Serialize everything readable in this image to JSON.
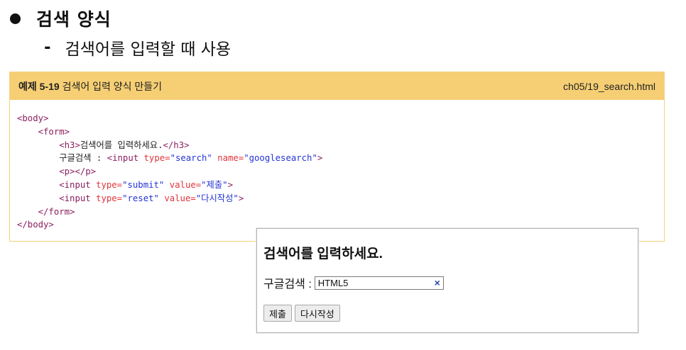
{
  "heading": "검색 양식",
  "subpoint": "검색어를 입력할 때 사용",
  "example": {
    "label": "예제 5-19",
    "title": "검색어 입력 양식 만들기",
    "filename": "ch05/19_search.html"
  },
  "code": {
    "l1": "<body>",
    "l2": "<form>",
    "l3a": "<h3>",
    "l3b": "검색어를 입력하세요.",
    "l3c": "</h3>",
    "l4a": "구글검색 : ",
    "l4b": "<input ",
    "l4c": "type=",
    "l4d": "\"search\"",
    "l4e": " name=",
    "l4f": "\"googlesearch\"",
    "l4g": ">",
    "l5": "<p></p>",
    "l6a": "<input ",
    "l6b": "type=",
    "l6c": "\"submit\"",
    "l6d": " value=",
    "l6e": "\"제출\"",
    "l6f": ">",
    "l7a": "<input ",
    "l7b": "type=",
    "l7c": "\"reset\"",
    "l7d": " value=",
    "l7e": "\"다시작성\"",
    "l7f": ">",
    "l8": "</form>",
    "l9": "</body>"
  },
  "result": {
    "heading": "검색어를 입력하세요.",
    "search_label": "구글검색 :",
    "search_value": "HTML5",
    "clear_symbol": "×",
    "submit_label": "제출",
    "reset_label": "다시작성"
  }
}
